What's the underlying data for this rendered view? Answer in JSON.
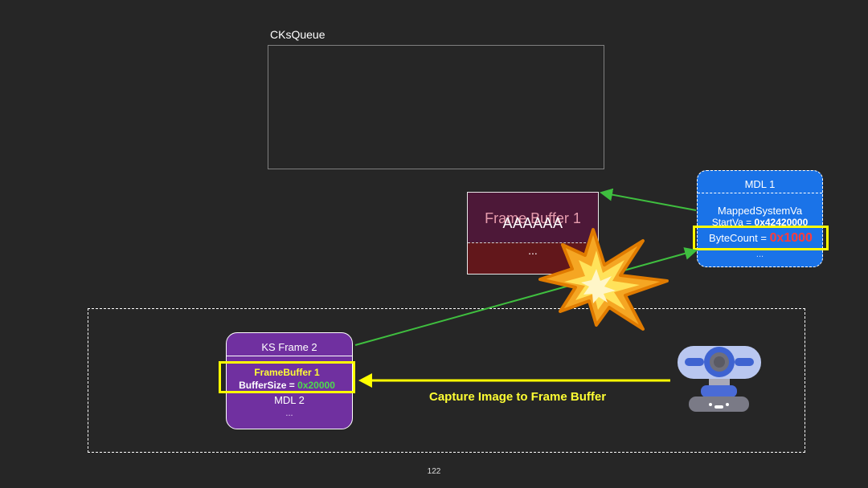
{
  "ksqueue": {
    "label": "CKsQueue"
  },
  "frame_buffer_1": {
    "title": "Frame Buffer 1",
    "content": "AAAAAA",
    "ellipsis": "..."
  },
  "mdl1": {
    "title": "MDL 1",
    "mapped_system_va": "MappedSystemVa",
    "start_va_label": "StartVa = ",
    "start_va_value": "0x42420000",
    "byte_count_label": "ByteCount = ",
    "byte_count_value": "0x1000",
    "ellipsis": "..."
  },
  "ks_frame_2": {
    "title": "KS Frame 2",
    "frame_buffer_label": "FrameBuffer 1",
    "buffer_size_label": "BufferSize = ",
    "buffer_size_value": "0x20000",
    "mdl": "MDL 2",
    "ellipsis": "..."
  },
  "capture_label": "Capture Image to Frame Buffer",
  "page_number": "122",
  "icons": [
    "explosion-icon",
    "webcam-icon"
  ],
  "colors": {
    "background": "#262626",
    "mdl_blue": "#1a73e8",
    "ks_frame_purple": "#7030a0",
    "highlight_yellow": "#ffff00",
    "arrow_green": "#3fbf3f",
    "alert_red": "#ff3b3b"
  }
}
